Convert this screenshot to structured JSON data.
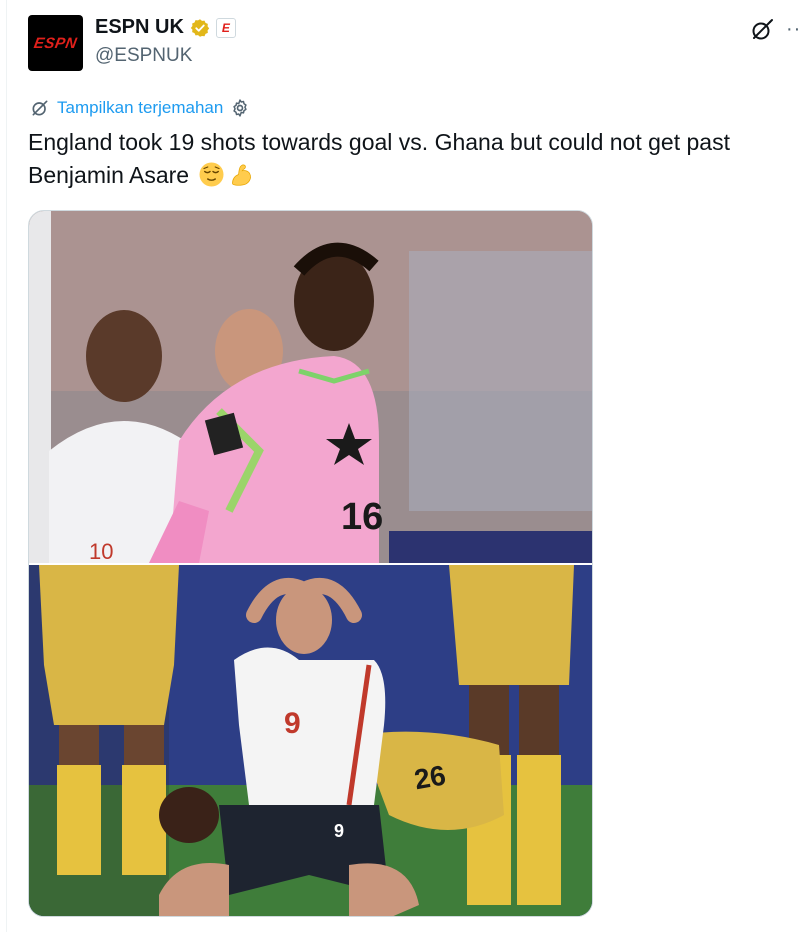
{
  "account": {
    "display_name": "ESPN UK",
    "handle": "@ESPNUK",
    "avatar_text": "ESPN",
    "affiliate_badge": "E"
  },
  "header_icons": {
    "grok": "grok-icon",
    "more": "···"
  },
  "translate": {
    "label": "Tampilkan terjemahan"
  },
  "tweet": {
    "text": "England took 19 shots towards goal vs. Ghana but could not get past Benjamin Asare",
    "emojis": [
      "relieved-face-emoji",
      "flexed-biceps-emoji"
    ]
  },
  "media": {
    "photos": [
      {
        "alt_role": "ghana-goalkeeper-photo",
        "jersey_number": "16",
        "background_player_number": "10"
      },
      {
        "alt_role": "england-striker-kneeling-photo",
        "jersey_number": "9",
        "shorts_number": "9",
        "ground_player_number": "26"
      }
    ]
  },
  "colors": {
    "text": "#0f1419",
    "secondary": "#536471",
    "link": "#1d9bf0",
    "verified_gold": "#e2b719",
    "espn_red": "#e0201b"
  }
}
